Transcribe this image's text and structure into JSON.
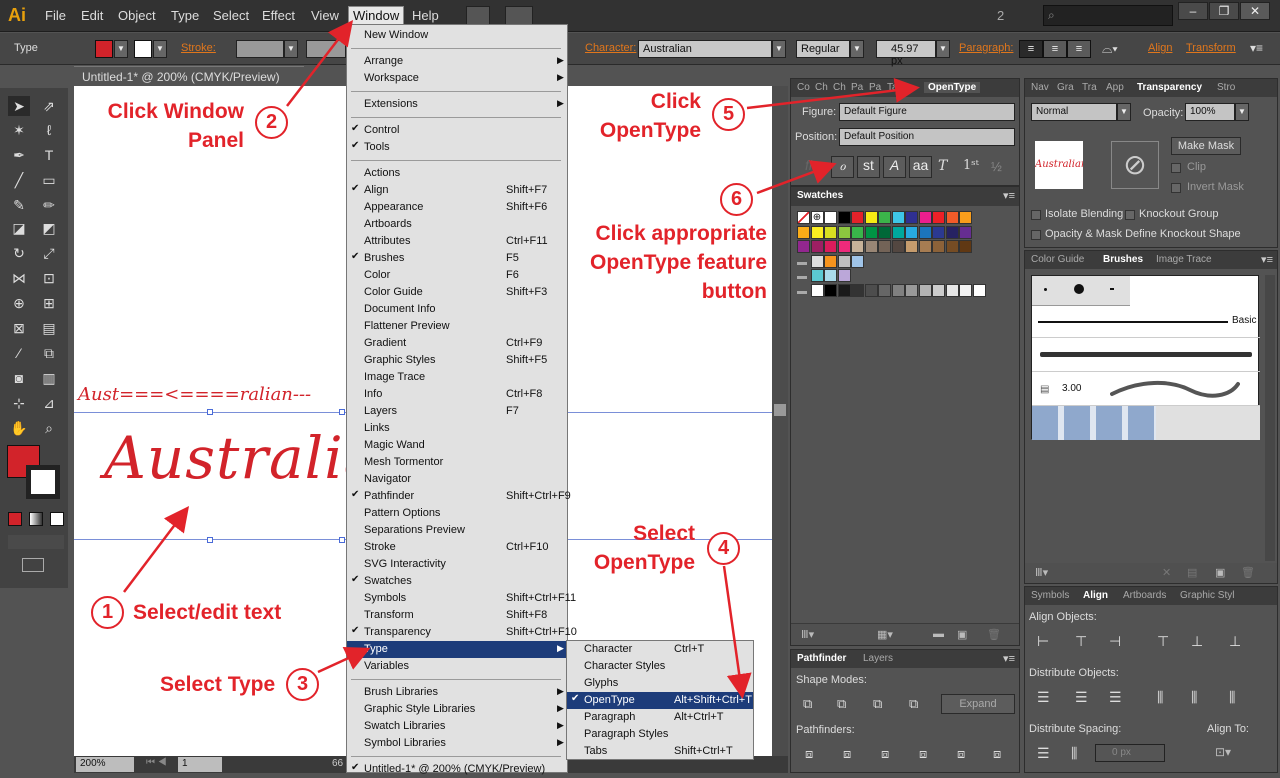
{
  "app": {
    "logo": "Ai",
    "workspace_num": "2"
  },
  "menubar": {
    "items": [
      "File",
      "Edit",
      "Object",
      "Type",
      "Select",
      "Effect",
      "View",
      "Window",
      "Help"
    ],
    "active": "Window"
  },
  "control": {
    "mode": "Type",
    "stroke_label": "Stroke:",
    "character_label": "Character:",
    "font": "Australian",
    "style": "Regular",
    "size": "45.97 px",
    "paragraph_label": "Paragraph:",
    "align_label": "Align",
    "transform_label": "Transform"
  },
  "document": {
    "tab_title": "Untitled-1* @ 200% (CMYK/Preview)",
    "small_text": "Aust===<====ralian---",
    "big_text": "Australian",
    "zoom": "200%",
    "page": "1",
    "page_extra": "66"
  },
  "window_menu": {
    "items": [
      {
        "label": "New Window",
        "shortcut": "",
        "check": false,
        "sub": false,
        "sep_after": true
      },
      {
        "label": "Arrange",
        "shortcut": "",
        "check": false,
        "sub": true,
        "sep_after": false
      },
      {
        "label": "Workspace",
        "shortcut": "",
        "check": false,
        "sub": true,
        "sep_after": true
      },
      {
        "label": "Extensions",
        "shortcut": "",
        "check": false,
        "sub": true,
        "sep_after": true
      },
      {
        "label": "Control",
        "shortcut": "",
        "check": true,
        "sub": false,
        "sep_after": false
      },
      {
        "label": "Tools",
        "shortcut": "",
        "check": true,
        "sub": false,
        "sep_after": true
      },
      {
        "label": "Actions",
        "shortcut": "",
        "check": false,
        "sub": false,
        "sep_after": false
      },
      {
        "label": "Align",
        "shortcut": "Shift+F7",
        "check": true,
        "sub": false,
        "sep_after": false
      },
      {
        "label": "Appearance",
        "shortcut": "Shift+F6",
        "check": false,
        "sub": false,
        "sep_after": false
      },
      {
        "label": "Artboards",
        "shortcut": "",
        "check": false,
        "sub": false,
        "sep_after": false
      },
      {
        "label": "Attributes",
        "shortcut": "Ctrl+F11",
        "check": false,
        "sub": false,
        "sep_after": false
      },
      {
        "label": "Brushes",
        "shortcut": "F5",
        "check": true,
        "sub": false,
        "sep_after": false
      },
      {
        "label": "Color",
        "shortcut": "F6",
        "check": false,
        "sub": false,
        "sep_after": false
      },
      {
        "label": "Color Guide",
        "shortcut": "Shift+F3",
        "check": false,
        "sub": false,
        "sep_after": false
      },
      {
        "label": "Document Info",
        "shortcut": "",
        "check": false,
        "sub": false,
        "sep_after": false
      },
      {
        "label": "Flattener Preview",
        "shortcut": "",
        "check": false,
        "sub": false,
        "sep_after": false
      },
      {
        "label": "Gradient",
        "shortcut": "Ctrl+F9",
        "check": false,
        "sub": false,
        "sep_after": false
      },
      {
        "label": "Graphic Styles",
        "shortcut": "Shift+F5",
        "check": false,
        "sub": false,
        "sep_after": false
      },
      {
        "label": "Image Trace",
        "shortcut": "",
        "check": false,
        "sub": false,
        "sep_after": false
      },
      {
        "label": "Info",
        "shortcut": "Ctrl+F8",
        "check": false,
        "sub": false,
        "sep_after": false
      },
      {
        "label": "Layers",
        "shortcut": "F7",
        "check": false,
        "sub": false,
        "sep_after": false
      },
      {
        "label": "Links",
        "shortcut": "",
        "check": false,
        "sub": false,
        "sep_after": false
      },
      {
        "label": "Magic Wand",
        "shortcut": "",
        "check": false,
        "sub": false,
        "sep_after": false
      },
      {
        "label": "Mesh Tormentor",
        "shortcut": "",
        "check": false,
        "sub": false,
        "sep_after": false
      },
      {
        "label": "Navigator",
        "shortcut": "",
        "check": false,
        "sub": false,
        "sep_after": false
      },
      {
        "label": "Pathfinder",
        "shortcut": "Shift+Ctrl+F9",
        "check": true,
        "sub": false,
        "sep_after": false
      },
      {
        "label": "Pattern Options",
        "shortcut": "",
        "check": false,
        "sub": false,
        "sep_after": false
      },
      {
        "label": "Separations Preview",
        "shortcut": "",
        "check": false,
        "sub": false,
        "sep_after": false
      },
      {
        "label": "Stroke",
        "shortcut": "Ctrl+F10",
        "check": false,
        "sub": false,
        "sep_after": false
      },
      {
        "label": "SVG Interactivity",
        "shortcut": "",
        "check": false,
        "sub": false,
        "sep_after": false
      },
      {
        "label": "Swatches",
        "shortcut": "",
        "check": true,
        "sub": false,
        "sep_after": false
      },
      {
        "label": "Symbols",
        "shortcut": "Shift+Ctrl+F11",
        "check": false,
        "sub": false,
        "sep_after": false
      },
      {
        "label": "Transform",
        "shortcut": "Shift+F8",
        "check": false,
        "sub": false,
        "sep_after": false
      },
      {
        "label": "Transparency",
        "shortcut": "Shift+Ctrl+F10",
        "check": true,
        "sub": false,
        "sep_after": false
      },
      {
        "label": "Type",
        "shortcut": "",
        "check": false,
        "sub": true,
        "sep_after": false,
        "highlight": true
      },
      {
        "label": "Variables",
        "shortcut": "",
        "check": false,
        "sub": false,
        "sep_after": true
      },
      {
        "label": "Brush Libraries",
        "shortcut": "",
        "check": false,
        "sub": true,
        "sep_after": false
      },
      {
        "label": "Graphic Style Libraries",
        "shortcut": "",
        "check": false,
        "sub": true,
        "sep_after": false
      },
      {
        "label": "Swatch Libraries",
        "shortcut": "",
        "check": false,
        "sub": true,
        "sep_after": false
      },
      {
        "label": "Symbol Libraries",
        "shortcut": "",
        "check": false,
        "sub": true,
        "sep_after": true
      },
      {
        "label": "Untitled-1* @ 200% (CMYK/Preview)",
        "shortcut": "",
        "check": true,
        "sub": false,
        "sep_after": false
      }
    ]
  },
  "type_menu": {
    "items": [
      {
        "label": "Character",
        "shortcut": "Ctrl+T",
        "check": false
      },
      {
        "label": "Character Styles",
        "shortcut": "",
        "check": false
      },
      {
        "label": "Glyphs",
        "shortcut": "",
        "check": false
      },
      {
        "label": "OpenType",
        "shortcut": "Alt+Shift+Ctrl+T",
        "check": true,
        "highlight": true
      },
      {
        "label": "Paragraph",
        "shortcut": "Alt+Ctrl+T",
        "check": false
      },
      {
        "label": "Paragraph Styles",
        "shortcut": "",
        "check": false
      },
      {
        "label": "Tabs",
        "shortcut": "Shift+Ctrl+T",
        "check": false
      }
    ]
  },
  "opentype_panel": {
    "tabs": [
      "Co",
      "Ch",
      "Ch",
      "Pa",
      "Pa",
      "Ta",
      "OpenType"
    ],
    "figure_label": "Figure:",
    "figure_value": "Default Figure",
    "position_label": "Position:",
    "position_value": "Default Position"
  },
  "swatches_panel": {
    "title": "Swatches"
  },
  "pathfinder_panel": {
    "tabs": [
      "Pathfinder",
      "Layers"
    ],
    "shape_modes": "Shape Modes:",
    "pathfinders": "Pathfinders:",
    "expand": "Expand"
  },
  "transparency_panel": {
    "tabs": [
      "Nav",
      "Gra",
      "Tra",
      "App",
      "Transparency",
      "Stro"
    ],
    "blend": "Normal",
    "opacity_label": "Opacity:",
    "opacity": "100%",
    "make_mask": "Make Mask",
    "clip": "Clip",
    "invert_mask": "Invert Mask",
    "isolate": "Isolate Blending",
    "knockout": "Knockout Group",
    "opacity_mask": "Opacity & Mask Define Knockout Shape",
    "thumb_text": "Australian"
  },
  "brushes_panel": {
    "tabs": [
      "Color Guide",
      "Brushes",
      "Image Trace"
    ],
    "basic": "Basic",
    "size": "3.00"
  },
  "align_panel": {
    "tabs": [
      "Symbols",
      "Align",
      "Artboards",
      "Graphic Styl"
    ],
    "align_objects": "Align Objects:",
    "distribute_objects": "Distribute Objects:",
    "distribute_spacing": "Distribute Spacing:",
    "align_to": "Align To:",
    "spacing_value": "0 px"
  },
  "annotations": {
    "step1": "Select/edit text",
    "step2": "Click Window\nPanel",
    "step3": "Select Type",
    "step4": "Select\nOpenType",
    "step5": "Click\nOpenType",
    "step6": "Click appropriate\nOpenType feature\nbutton",
    "n1": "1",
    "n2": "2",
    "n3": "3",
    "n4": "4",
    "n5": "5",
    "n6": "6"
  },
  "colors": {
    "accent": "#e2232a",
    "menu_highlight": "#1d3c7a",
    "ai_orange": "#e8a00c"
  }
}
